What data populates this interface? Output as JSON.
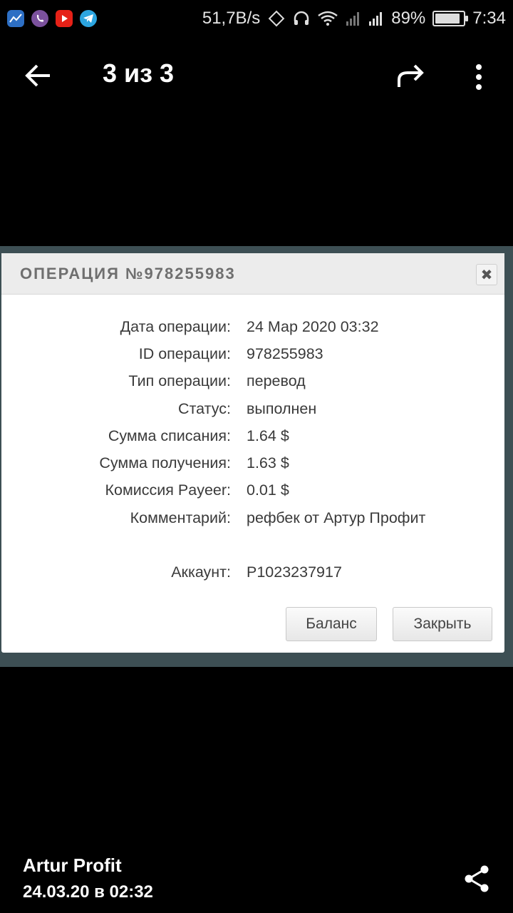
{
  "status_bar": {
    "apps": [
      "stocks-app-icon",
      "viber-icon",
      "youtube-icon",
      "telegram-icon"
    ],
    "net_speed": "51,7B/s",
    "battery": "89%",
    "battery_level": 0.89,
    "time": "7:34"
  },
  "toolbar": {
    "title": "3 из 3"
  },
  "dialog": {
    "title": "ОПЕРАЦИЯ №978255983",
    "close_glyph": "✖",
    "rows": [
      {
        "label": "Дата операции:",
        "value": "24 Мар 2020 03:32"
      },
      {
        "label": "ID операции:",
        "value": "978255983"
      },
      {
        "label": "Тип операции:",
        "value": "перевод"
      },
      {
        "label": "Статус:",
        "value": "выполнен"
      },
      {
        "label": "Сумма списания:",
        "value": "1.64 $"
      },
      {
        "label": "Сумма получения:",
        "value": "1.63 $"
      },
      {
        "label": "Комиссия Payeer:",
        "value": "0.01 $"
      },
      {
        "label": "Комментарий:",
        "value": "рефбек от Артур Профит"
      }
    ],
    "account": {
      "label": "Аккаунт:",
      "value": "P1023237917"
    },
    "buttons": {
      "balance": "Баланс",
      "close": "Закрыть"
    }
  },
  "footer": {
    "sender": "Artur Profit",
    "date": "24.03.20 в 02:32"
  },
  "colors": {
    "background": "#000000",
    "photo_bg": "#3d4f54",
    "dialog_header": "#ececec"
  }
}
